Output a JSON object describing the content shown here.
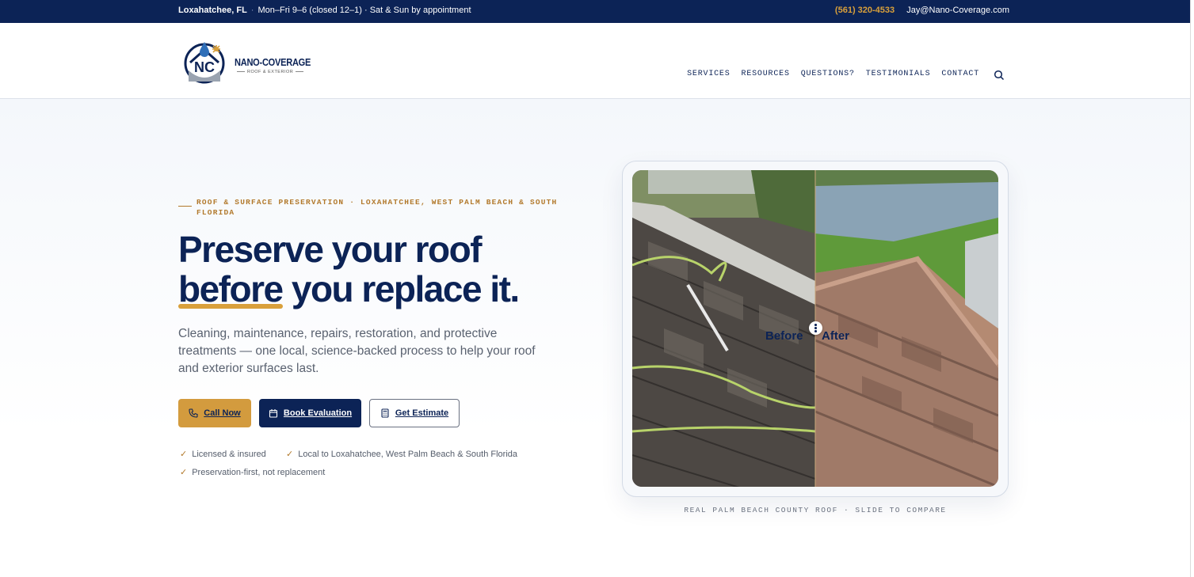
{
  "topbar": {
    "location": "Loxahatchee, FL",
    "separator": "·",
    "hours": "Mon–Fri 9–6 (closed 12–1) · Sat & Sun by appointment",
    "phone": "(561) 320-4533",
    "email": "Jay@Nano-Coverage.com"
  },
  "brand": {
    "name": "NANO-COVERAGE",
    "tagline": "ROOF & EXTERIOR",
    "monogram": "NC",
    "colors": {
      "navy": "#0c2356",
      "gold": "#d39b3e"
    }
  },
  "nav": {
    "items": [
      "SERVICES",
      "RESOURCES",
      "QUESTIONS?",
      "TESTIMONIALS",
      "CONTACT"
    ],
    "search_icon": "search-icon"
  },
  "hero": {
    "eyebrow": "ROOF & SURFACE PRESERVATION · LOXAHATCHEE, WEST PALM BEACH & SOUTH FLORIDA",
    "headline_line1": "Preserve your roof",
    "headline_highlight": "before",
    "headline_rest": " you replace it.",
    "lede": "Cleaning, maintenance, repairs, restoration, and protective treatments — one local, science-backed process to help your roof and exterior surfaces last.",
    "buttons": {
      "call": "Call Now",
      "book": "Book Evaluation",
      "estimate": "Get Estimate"
    },
    "checks": [
      "Licensed & insured",
      "Local to Loxahatchee, West Palm Beach & South Florida",
      "Preservation-first, not replacement"
    ]
  },
  "compare": {
    "before_label": "Before",
    "after_label": "After",
    "caption": "REAL PALM BEACH COUNTY ROOF · SLIDE TO COMPARE",
    "slider_position_fraction": 0.5
  }
}
